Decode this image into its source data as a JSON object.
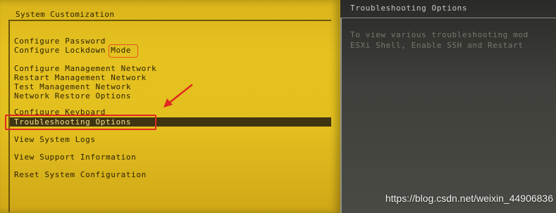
{
  "left": {
    "title": "System Customization",
    "menu": [
      "Configure Password",
      "Configure Lockdown Mode",
      "Configure Management Network",
      "Restart Management Network",
      "Test Management Network",
      "Network Restore Options",
      "Configure Keyboard",
      "Troubleshooting Options",
      "View System Logs",
      "View Support Information",
      "Reset System Configuration"
    ],
    "selected_item": "Troubleshooting Options"
  },
  "right": {
    "title": "Troubleshooting Options",
    "description": [
      "To view various troubleshooting mod",
      "ESXi Shell, Enable SSH and Restart"
    ]
  },
  "watermark": "https://blog.csdn.net/weixin_44906836",
  "colors": {
    "panel_yellow": "#e3bf1f",
    "selection_bar": "#3f3512",
    "annotation_red": "#e0281f",
    "right_panel": "#3f3f3b"
  }
}
